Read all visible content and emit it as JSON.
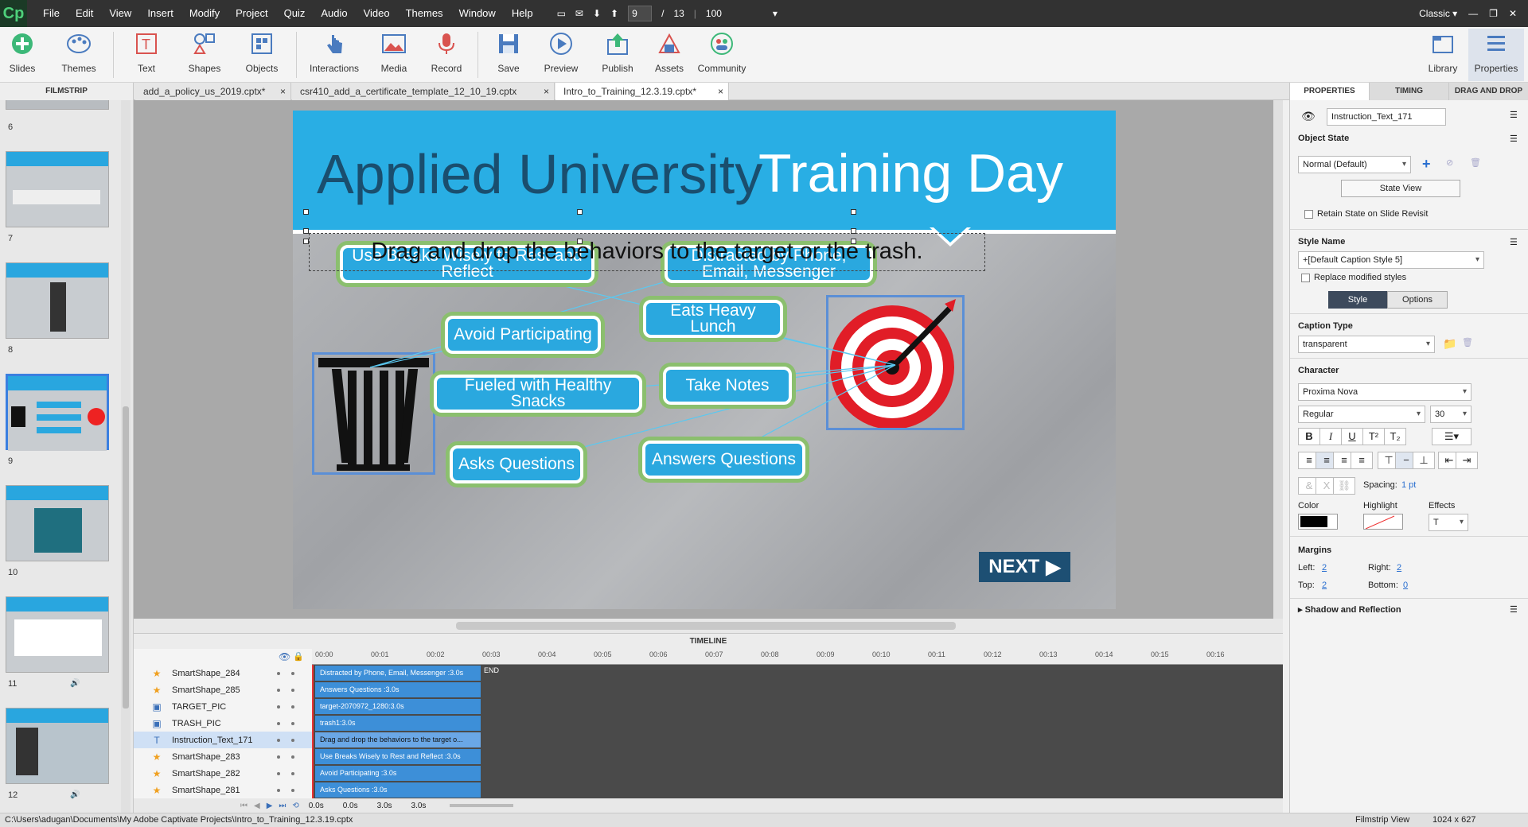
{
  "app": {
    "logo": "Cp",
    "workspace": "Classic"
  },
  "menu": [
    "File",
    "Edit",
    "View",
    "Insert",
    "Modify",
    "Project",
    "Quiz",
    "Audio",
    "Video",
    "Themes",
    "Window",
    "Help"
  ],
  "nav": {
    "page": "9",
    "sep": "/",
    "total": "13",
    "zoom": "100"
  },
  "toolbar": {
    "slides": "Slides",
    "themes": "Themes",
    "text": "Text",
    "shapes": "Shapes",
    "objects": "Objects",
    "interactions": "Interactions",
    "media": "Media",
    "record": "Record",
    "save": "Save",
    "preview": "Preview",
    "publish": "Publish",
    "assets": "Assets",
    "community": "Community",
    "library": "Library",
    "properties": "Properties"
  },
  "filmstrip_title": "FILMSTRIP",
  "doc_tabs": [
    {
      "label": "add_a_policy_us_2019.cptx*",
      "close": "×"
    },
    {
      "label": "csr410_add_a_certificate_template_12_10_19.cptx",
      "close": "×"
    },
    {
      "label": "Intro_to_Training_12.3.19.cptx*",
      "close": "×"
    }
  ],
  "panel_tabs": [
    "PROPERTIES",
    "TIMING",
    "DRAG AND DROP"
  ],
  "thumbs": [
    {
      "num": "6"
    },
    {
      "num": "7"
    },
    {
      "num": "8"
    },
    {
      "num": "9"
    },
    {
      "num": "10"
    },
    {
      "num": "11"
    },
    {
      "num": "12"
    }
  ],
  "slide": {
    "title1": "Applied University",
    "title2": "Training Day",
    "instruction": "Drag and drop the behaviors to the target or the trash.",
    "boxes": {
      "b1": "Use Breaks Wisely to Rest and Reflect",
      "b2": "Distracted by Phone, Email, Messenger",
      "b3": "Eats Heavy Lunch",
      "b4": "Avoid Participating",
      "b5": "Fueled with Healthy Snacks",
      "b6": "Take Notes",
      "b7": "Asks Questions",
      "b8": "Answers Questions"
    },
    "next": "NEXT"
  },
  "timeline": {
    "title": "TIMELINE",
    "ticks": [
      "00:00",
      "00:01",
      "00:02",
      "00:03",
      "00:04",
      "00:05",
      "00:06",
      "00:07",
      "00:08",
      "00:09",
      "00:10",
      "00:11",
      "00:12",
      "00:13",
      "00:14",
      "00:15",
      "00:16"
    ],
    "end": "END",
    "rows": [
      {
        "name": "SmartShape_284",
        "icon": "star",
        "bar": "Distracted by Phone, Email, Messenger :3.0s"
      },
      {
        "name": "SmartShape_285",
        "icon": "star",
        "bar": "Answers Questions :3.0s"
      },
      {
        "name": "TARGET_PIC",
        "icon": "image",
        "bar": "target-2070972_1280:3.0s"
      },
      {
        "name": "TRASH_PIC",
        "icon": "image",
        "bar": "trash1:3.0s"
      },
      {
        "name": "Instruction_Text_171",
        "icon": "text",
        "bar": "Drag and drop the behaviors to the target o..."
      },
      {
        "name": "SmartShape_283",
        "icon": "star",
        "bar": "Use Breaks Wisely to Rest and Reflect :3.0s"
      },
      {
        "name": "SmartShape_282",
        "icon": "star",
        "bar": "Avoid Participating :3.0s"
      },
      {
        "name": "SmartShape_281",
        "icon": "star",
        "bar": "Asks Questions :3.0s"
      }
    ],
    "bottom": {
      "t1": "0.0s",
      "t2": "0.0s",
      "t3": "3.0s",
      "t4": "3.0s"
    }
  },
  "props": {
    "name": "Instruction_Text_171",
    "object_state": "Object State",
    "state_value": "Normal (Default)",
    "state_view": "State View",
    "retain": "Retain State on Slide Revisit",
    "style_name": "Style Name",
    "style_value": "+[Default Caption Style 5]",
    "replace": "Replace modified styles",
    "style_tab": "Style",
    "options_tab": "Options",
    "caption_type": "Caption Type",
    "caption_value": "transparent",
    "character": "Character",
    "font": "Proxima Nova",
    "weight": "Regular",
    "size": "30",
    "spacing_label": "Spacing:",
    "spacing_value": "1 pt",
    "color": "Color",
    "highlight": "Highlight",
    "effects": "Effects",
    "effects_value": "T",
    "margins": "Margins",
    "left_label": "Left:",
    "left": "2",
    "right_label": "Right:",
    "right": "2",
    "top_label": "Top:",
    "top": "2",
    "bottom_label": "Bottom:",
    "bottom": "0",
    "shadow": "Shadow and Reflection"
  },
  "status": {
    "path": "C:\\Users\\adugan\\Documents\\My Adobe Captivate Projects\\Intro_to_Training_12.3.19.cptx",
    "view": "Filmstrip View",
    "size": "1024 x 627"
  },
  "colors": {
    "accent": "#29aee4",
    "dark": "#1a4e6e",
    "panel": "#f3f3f3"
  }
}
